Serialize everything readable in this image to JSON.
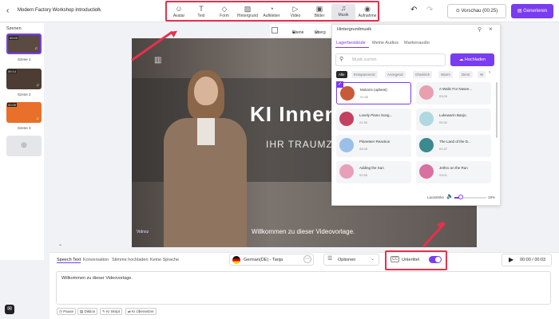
{
  "header": {
    "back_icon": "chevron-left-icon",
    "project_title": "Modern Factory Workshop Introduction",
    "edit_icon": "pencil-icon",
    "undo_icon": "undo-icon",
    "redo_icon": "redo-icon",
    "preview_label": "Vorschau (00:25)",
    "generate_label": "Generieren"
  },
  "toolbar": {
    "items": [
      {
        "label": "Avatar",
        "icon": "avatar-icon"
      },
      {
        "label": "Text",
        "icon": "text-icon"
      },
      {
        "label": "Form",
        "icon": "shapes-icon"
      },
      {
        "label": "Hintergrund",
        "icon": "background-icon"
      },
      {
        "label": "Aufkleber",
        "icon": "sticker-icon"
      },
      {
        "label": "Video",
        "icon": "video-icon"
      },
      {
        "label": "Bilder",
        "icon": "image-icon"
      },
      {
        "label": "Musik",
        "icon": "music-icon"
      },
      {
        "label": "Aufnahme",
        "icon": "record-icon"
      }
    ],
    "active": "Musik"
  },
  "scenes": {
    "label": "Szenen",
    "items": [
      {
        "time": "00:03",
        "label": "Szene 1"
      },
      {
        "time": "00:14",
        "label": "Szene 2"
      },
      {
        "time": "00:09",
        "label": "Szene 3"
      }
    ],
    "add_icon": "plus-icon"
  },
  "canvas": {
    "tools": {
      "layer": "Ebene",
      "overlay": "Überg"
    },
    "headline": "KI Innen",
    "subline": "IHR TRAUMZIM",
    "caption": "Willkommen zu dieser Videovorlage.",
    "watermark": "Vidnoz"
  },
  "music_panel": {
    "title": "Hintergrundmusik",
    "tabs": [
      "Lagerbestände",
      "Meine Audios",
      "Markenaudio"
    ],
    "search_placeholder": "Musik suchen",
    "upload_label": "Hochladen",
    "filters": [
      "Alle",
      "Entspannend",
      "Anregend",
      "Glücklich",
      "Warm",
      "Dient",
      "W"
    ],
    "tracks": [
      {
        "name": "Motions (upbeat)",
        "duration": "01:56",
        "color": "#c85a3a"
      },
      {
        "name": "A Waltz For Nasee...",
        "duration": "03:26",
        "color": "#e8a0b0"
      },
      {
        "name": "Lovely Piano Song...",
        "duration": "01:30",
        "color": "#c44060"
      },
      {
        "name": "Lukewarm Banjo.",
        "duration": "00:32",
        "color": "#b0d8e0"
      },
      {
        "name": "Planeteer Reaction",
        "duration": "04:08",
        "color": "#9ac0e8"
      },
      {
        "name": "The Land of the D...",
        "duration": "01:47",
        "color": "#3a8a90"
      },
      {
        "name": "Adding the Sun",
        "duration": "02:56",
        "color": "#e8a0b8"
      },
      {
        "name": "Jethro on the Run",
        "duration": "03:01",
        "color": "#d870a0"
      }
    ],
    "volume_label": "Lautstärke",
    "volume_value": "18%",
    "volume_fraction": 0.18
  },
  "editor": {
    "tabs": [
      "Speech Text",
      "Konversation",
      "Stimme hochladen",
      "Keine Sprache"
    ],
    "voice": "German(DE) - Tanja",
    "options_label": "Optionen",
    "subtitle_label": "Untertitel",
    "subtitle_on": true,
    "playback": "00:00 / 00:03",
    "speech_text": "Willkommen zu dieser Videovorlage.",
    "footer_buttons": [
      "Pause",
      "Diktion",
      "KI Skript",
      "KI Übersetzer"
    ]
  },
  "colors": {
    "accent": "#7a3cf0",
    "highlight": "#e8304c"
  }
}
